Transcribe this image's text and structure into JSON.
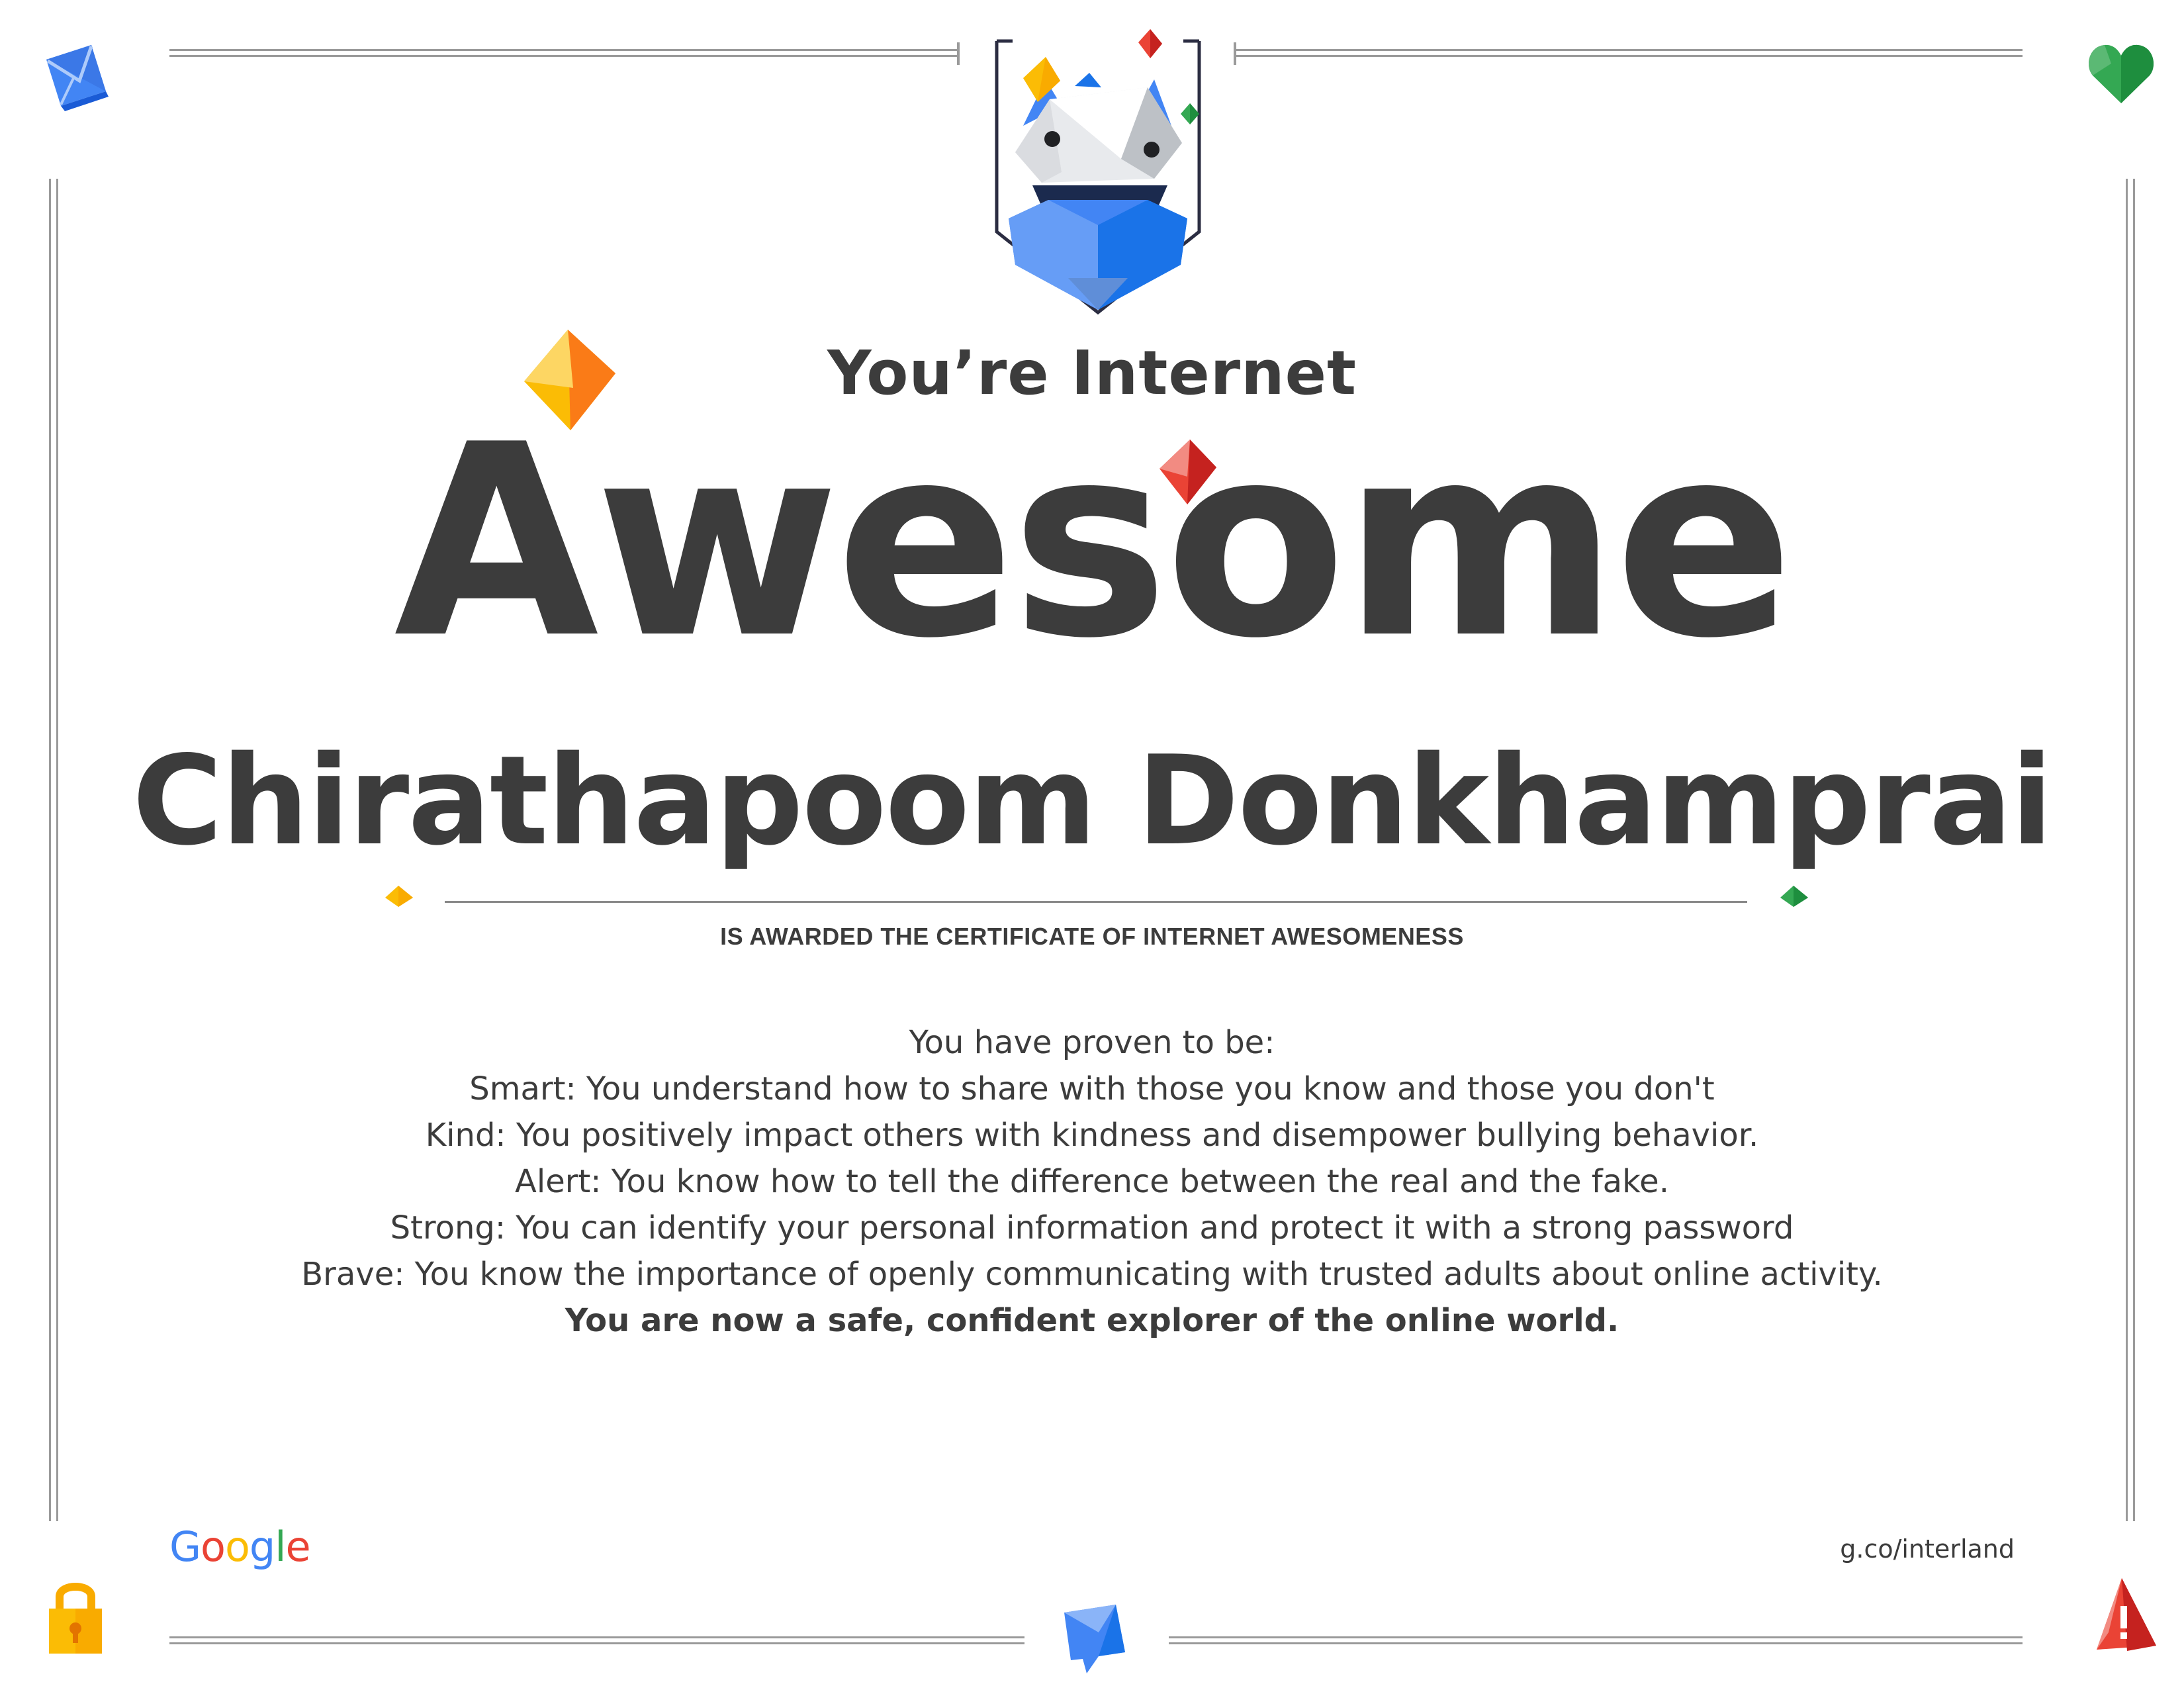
{
  "certificate": {
    "subtitle": "You’re Internet",
    "headline": "Awesome",
    "recipient_name": "Chirathapoom Donkhamprai",
    "award_line": "IS AWARDED THE CERTIFICATE OF INTERNET AWESOMENESS",
    "intro": "You have proven to be:",
    "traits": [
      "Smart: You understand how to share with those you know and those you don't",
      "Kind: You positively impact others with kindness and disempower bullying behavior.",
      "Alert: You know how to tell the difference between the real and the fake.",
      "Strong: You can identify your personal information and protect it with a strong password",
      "Brave: You know the importance of openly communicating with trusted adults about online activity."
    ],
    "closing": "You are now a safe, confident explorer of the online world."
  },
  "footer": {
    "logo_text": "Google",
    "logo_letters": [
      {
        "char": "G",
        "color": "#4285F4"
      },
      {
        "char": "o",
        "color": "#EA4335"
      },
      {
        "char": "o",
        "color": "#FBBC05"
      },
      {
        "char": "g",
        "color": "#4285F4"
      },
      {
        "char": "l",
        "color": "#34A853"
      },
      {
        "char": "e",
        "color": "#EA4335"
      }
    ],
    "url": "g.co/interland"
  },
  "icons": {
    "top_left": "envelope-icon",
    "top_right": "heart-icon",
    "bottom_left": "padlock-icon",
    "bottom_center": "speech-bubble-icon",
    "bottom_right": "warning-triangle-icon",
    "mascot": "interland-robot-mascot"
  },
  "colors": {
    "text": "#3c3c3c",
    "rule": "#9a9a9a",
    "blue": "#4285F4",
    "red": "#EA4335",
    "yellow": "#FBBC05",
    "green": "#34A853"
  }
}
